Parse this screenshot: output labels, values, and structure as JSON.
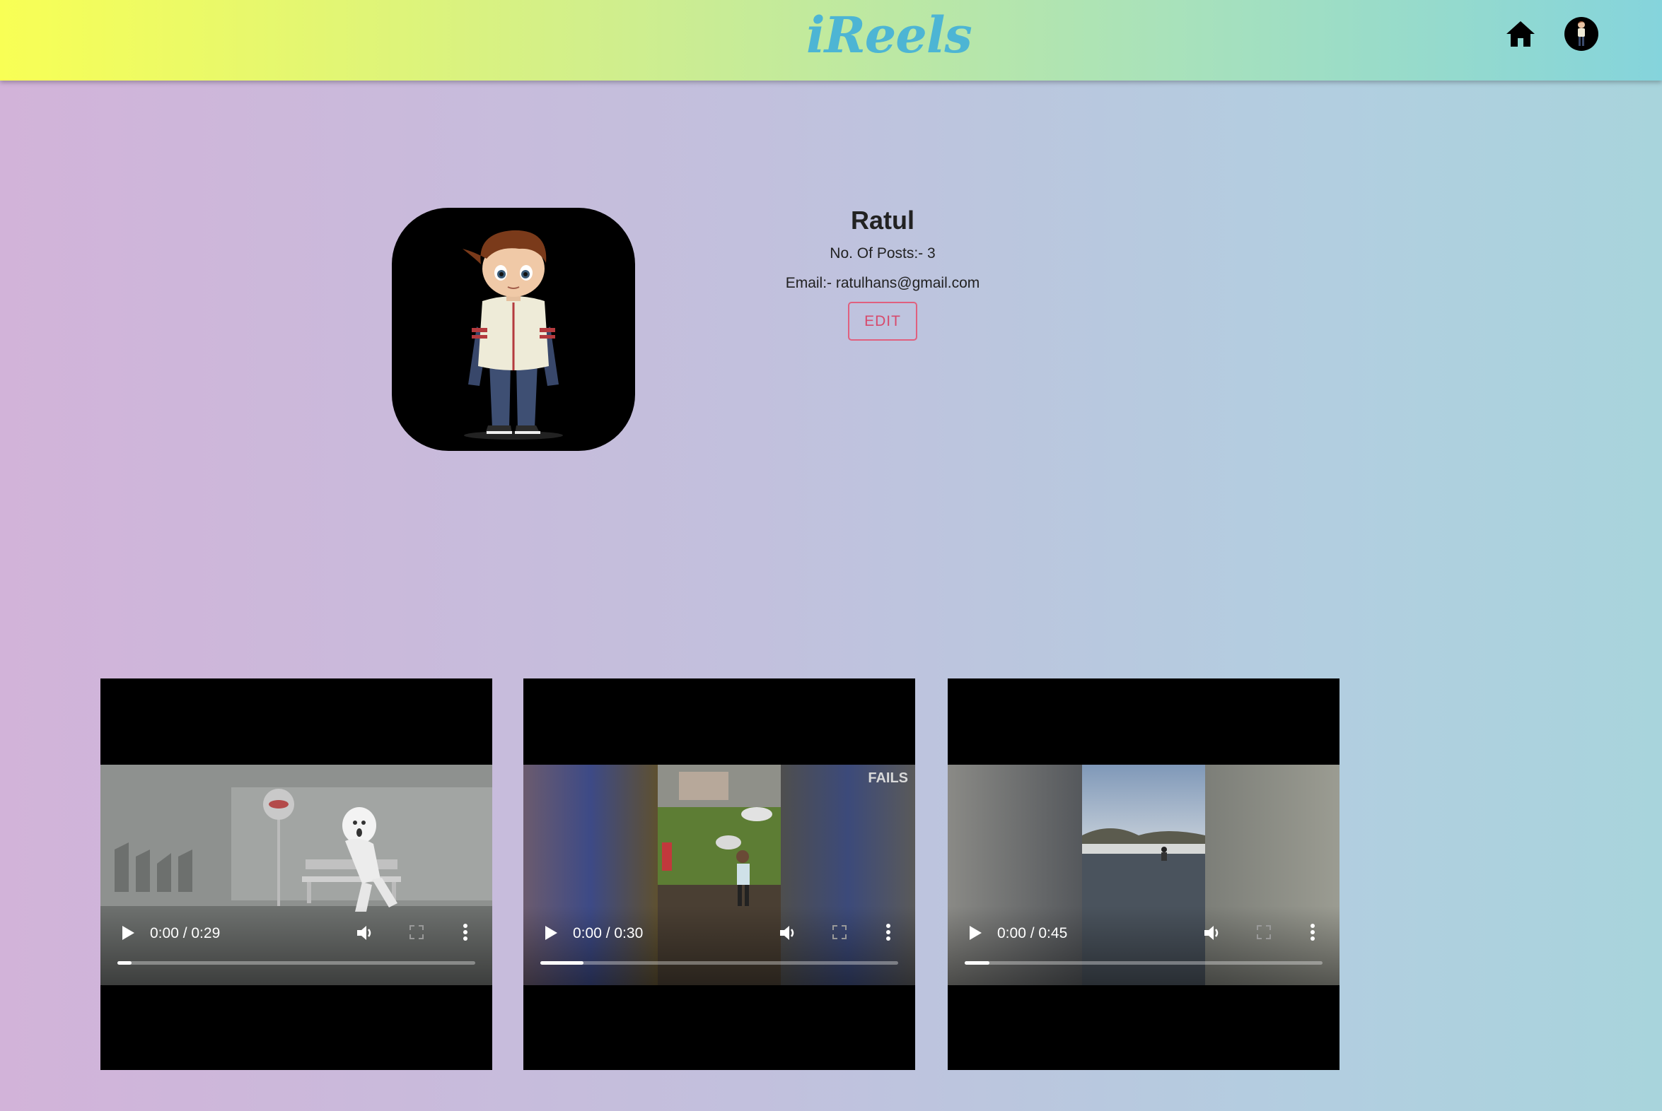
{
  "app": {
    "logo": "iReels"
  },
  "nav": {
    "home_icon": "home-icon",
    "avatar_icon": "user-avatar"
  },
  "profile": {
    "name": "Ratul",
    "posts_label": "No. Of Posts:- 3",
    "email_label": "Email:- ratulhans@gmail.com",
    "edit_label": "EDIT"
  },
  "videos": [
    {
      "time": "0:00 / 0:29",
      "progress": 0.04,
      "watermark": ""
    },
    {
      "time": "0:00 / 0:30",
      "progress": 0.12,
      "watermark": "FAILS"
    },
    {
      "time": "0:00 / 0:45",
      "progress": 0.07,
      "watermark": ""
    }
  ],
  "colors": {
    "accent": "#4db5d4",
    "edit": "#d74a6c"
  }
}
